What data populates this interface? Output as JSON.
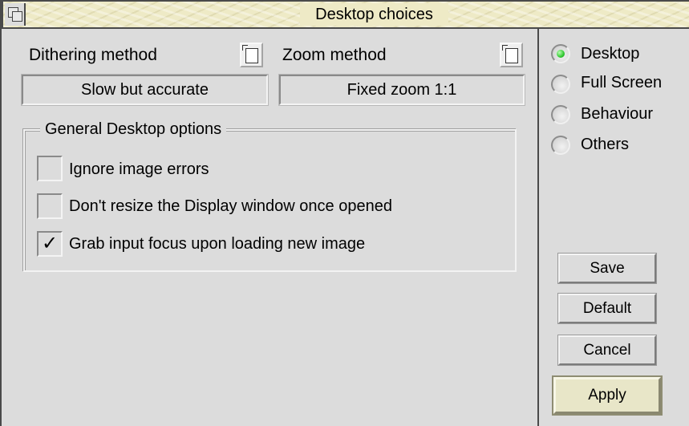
{
  "window": {
    "title": "Desktop choices"
  },
  "dithering": {
    "label": "Dithering method",
    "value": "Slow but accurate"
  },
  "zoom": {
    "label": "Zoom method",
    "value": "Fixed zoom 1:1"
  },
  "general": {
    "title": "General Desktop options",
    "options": [
      {
        "label": "Ignore image errors",
        "checked": false
      },
      {
        "label": "Don't resize the Display window once opened",
        "checked": false
      },
      {
        "label": "Grab input focus upon loading new image",
        "checked": true
      }
    ],
    "check_mark": "✓"
  },
  "sections": {
    "items": [
      {
        "label": "Desktop",
        "selected": true
      },
      {
        "label": "Full Screen",
        "selected": false
      },
      {
        "label": "Behaviour",
        "selected": false
      },
      {
        "label": "Others",
        "selected": false
      }
    ]
  },
  "buttons": {
    "save": "Save",
    "default": "Default",
    "cancel": "Cancel",
    "apply": "Apply"
  },
  "icons": {
    "back": "back-icon",
    "menu": "popup-menu-icon",
    "radio_selected_color": "#32c832"
  }
}
